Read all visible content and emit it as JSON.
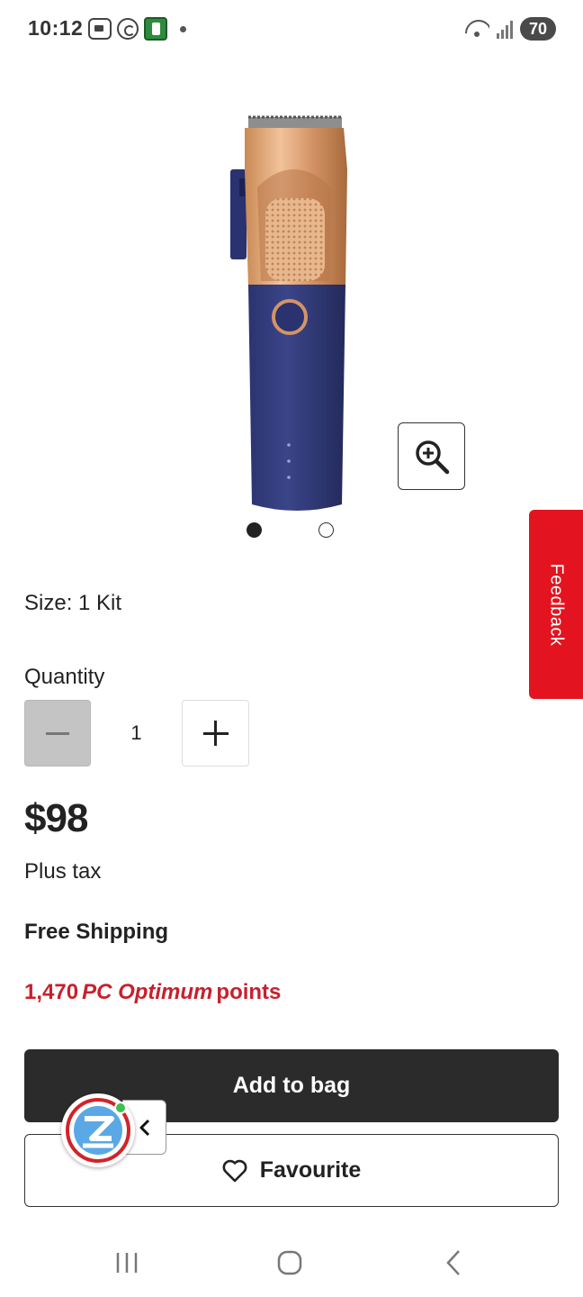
{
  "status_bar": {
    "time": "10:12",
    "battery": "70"
  },
  "product": {
    "image_alt": "Hair clipper",
    "size_label": "Size: 1 Kit",
    "quantity_label": "Quantity",
    "quantity_value": "1",
    "price": "$98",
    "tax_note": "Plus tax",
    "shipping": "Free Shipping",
    "points": {
      "amount": "1,470",
      "brand": "PC Optimum",
      "suffix": "points"
    },
    "image_count": 2,
    "active_image_index": 0
  },
  "feedback": {
    "label": "Feedback"
  },
  "actions": {
    "add_to_bag": "Add to bag",
    "favourite": "Favourite"
  },
  "icons": {
    "zoom": "zoom-in-icon",
    "heart": "heart-icon",
    "assistant": "assistant-logo-icon",
    "collapse": "chevron-left-icon"
  },
  "colors": {
    "accent_red": "#e3141f",
    "points_red": "#c8202c",
    "primary_button": "#2b2b2b"
  }
}
